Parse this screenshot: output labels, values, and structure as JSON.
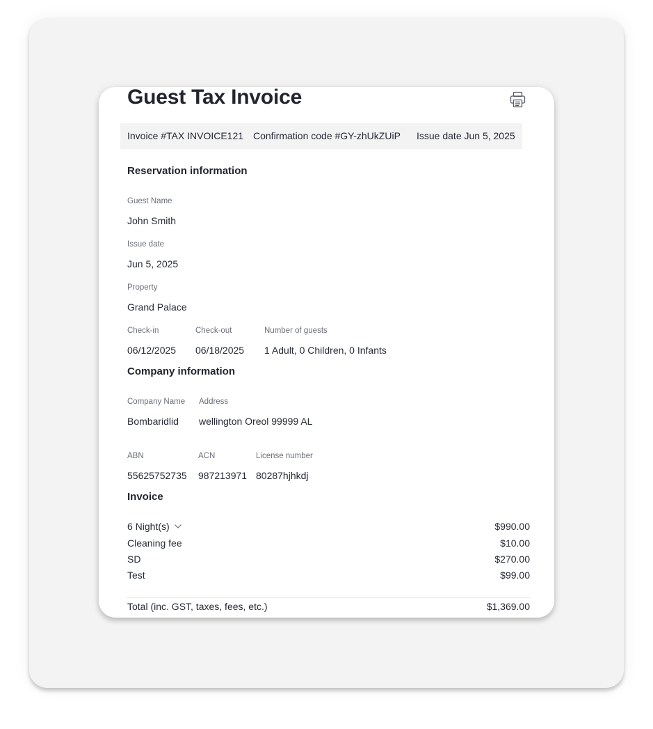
{
  "invoice": {
    "title": "Guest Tax Invoice",
    "meta": {
      "invoice_number": "Invoice #TAX INVOICE121",
      "confirmation_code": "Confirmation code #GY-zhUkZUiP",
      "issue_date": "Issue date Jun 5, 2025"
    },
    "reservation": {
      "heading": "Reservation information",
      "guest_name_label": "Guest Name",
      "guest_name": "John Smith",
      "issue_date_label": "Issue date",
      "issue_date": "Jun 5, 2025",
      "property_label": "Property",
      "property": "Grand Palace",
      "checkin_label": "Check-in",
      "checkin": "06/12/2025",
      "checkout_label": "Check-out",
      "checkout": "06/18/2025",
      "guests_label": "Number of guests",
      "guests": "1 Adult, 0 Children, 0 Infants"
    },
    "company": {
      "heading": "Company information",
      "name_label": "Company Name",
      "name": "Bombaridlid",
      "address_label": "Address",
      "address": "wellington Oreol 99999 AL",
      "abn_label": "ABN",
      "abn": "55625752735",
      "acn_label": "ACN",
      "acn": "987213971",
      "license_label": "License number",
      "license": "80287hjhkdj"
    },
    "charges": {
      "heading": "Invoice",
      "lines": [
        {
          "label": "6 Night(s)",
          "amount": "$990.00",
          "expandable": true
        },
        {
          "label": "Cleaning fee",
          "amount": "$10.00"
        },
        {
          "label": "SD",
          "amount": "$270.00"
        },
        {
          "label": "Test",
          "amount": "$99.00"
        }
      ],
      "total_label": "Total (inc. GST, taxes, fees, etc.)",
      "total_amount": "$1,369.00"
    }
  },
  "icons": {
    "print": "printer-icon",
    "expand": "chevron-down-icon"
  }
}
